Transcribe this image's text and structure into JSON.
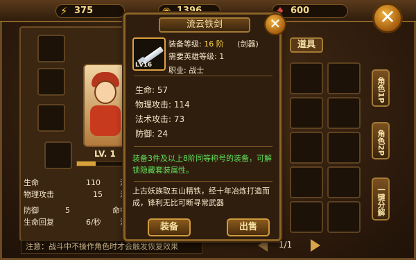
{
  "resources": {
    "stamina": "375",
    "gold": "1396",
    "gems": "600"
  },
  "character": {
    "level_label": "LV. 1",
    "stats": [
      {
        "label": "生命",
        "value": "110",
        "label2": "法"
      },
      {
        "label": "物理攻击",
        "value": "15",
        "label2": "法"
      },
      {
        "label": "防御",
        "value": "5",
        "label2": "命中"
      },
      {
        "label": "生命回复",
        "value": "6/秒",
        "label2": "法"
      }
    ]
  },
  "notice": "注意：战斗中不操作角色时才会触发恢复效果",
  "bag": {
    "title": "道具",
    "tabs": [
      "角色1P",
      "角色2P",
      "一键分解"
    ],
    "page": "1/1"
  },
  "popup": {
    "title": "流云铁剑",
    "item_level_tag": "Lv16",
    "equip_level_label": "装备等级:",
    "equip_level_value": "16 阶",
    "equip_type": "(剑器)",
    "hero_level": "需要英雄等级: 1",
    "job": "职业: 战士",
    "attributes": [
      "生命: 57",
      "物理攻击: 114",
      "法术攻击: 73",
      "防御: 24"
    ],
    "set_hint": "装备3件及以上8阶同等称号的装备，可解锁隐藏套装属性。",
    "description": "上古妖族取五山精铁，经十年冶炼打造而成，锋利无比可断寻常武器",
    "equip_button": "装备",
    "sell_button": "出售"
  }
}
